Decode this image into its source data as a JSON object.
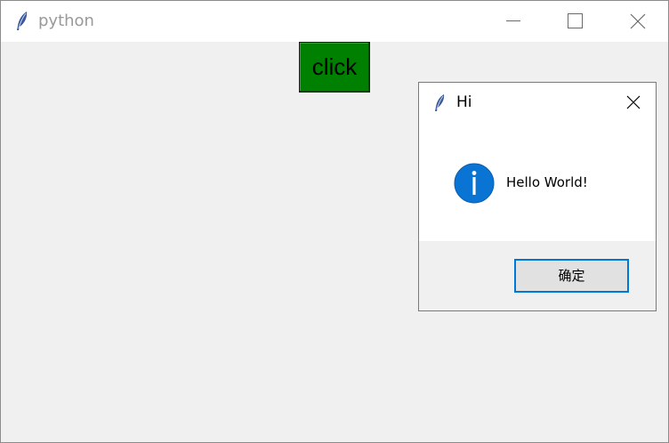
{
  "main_window": {
    "title": "python",
    "icon": "feather-icon",
    "controls": {
      "minimize": "minimize-icon",
      "maximize": "maximize-icon",
      "close": "close-icon"
    },
    "click_button": {
      "label": "click",
      "color": "#008000"
    }
  },
  "dialog": {
    "title": "Hi",
    "icon": "feather-icon",
    "message": "Hello World!",
    "message_icon": "info-icon",
    "info_color": "#0a74d4",
    "ok_label": "确定",
    "focus_color": "#0078d7"
  }
}
